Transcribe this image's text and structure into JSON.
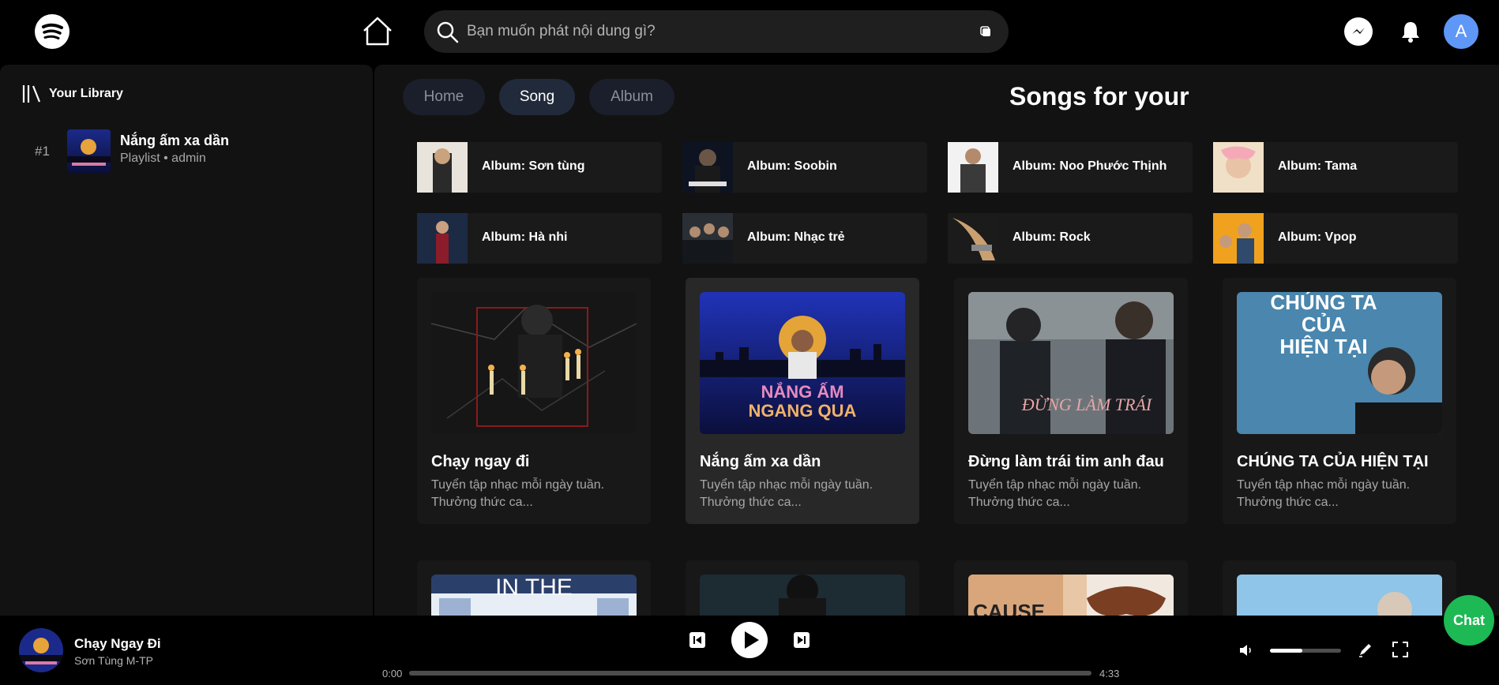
{
  "header": {
    "search_placeholder": "Bạn muốn phát nội dung gì?",
    "avatar_letter": "A"
  },
  "sidebar": {
    "library_label": "Your Library",
    "items": [
      {
        "rank": "#1",
        "title": "Nắng ấm xa dần",
        "subtitle": "Playlist • admin"
      }
    ]
  },
  "main": {
    "tabs": [
      {
        "label": "Home",
        "active": false
      },
      {
        "label": "Song",
        "active": true
      },
      {
        "label": "Album",
        "active": false
      }
    ],
    "section_title": "Songs for your",
    "albums": [
      {
        "label": "Album: Sơn tùng"
      },
      {
        "label": "Album: Soobin"
      },
      {
        "label": "Album: Noo Phước Thịnh"
      },
      {
        "label": "Album: Tama"
      },
      {
        "label": "Album: Hà nhi"
      },
      {
        "label": "Album: Nhạc trẻ"
      },
      {
        "label": "Album: Rock"
      },
      {
        "label": "Album: Vpop"
      }
    ],
    "songs": [
      {
        "title": "Chạy ngay đi",
        "desc": "Tuyển tập nhạc mỗi ngày tuần. Thưởng thức ca..."
      },
      {
        "title": "Nắng ấm xa dần",
        "desc": "Tuyển tập nhạc mỗi ngày tuần. Thưởng thức ca..."
      },
      {
        "title": "Đừng làm trái tim anh đau",
        "desc": "Tuyển tập nhạc mỗi ngày tuần. Thưởng thức ca..."
      },
      {
        "title": "CHÚNG TA CỦA HIỆN TẠI",
        "desc": "Tuyển tập nhạc mỗi ngày tuần. Thưởng thức ca..."
      }
    ],
    "cover_texts": {
      "nang_am_line1": "NẮNG ẤM",
      "nang_am_line2": "NGANG QUA",
      "dung_lam": "ĐỪNG LÀM TRÁI",
      "chung_ta_1": "CHÚNG TA",
      "chung_ta_2": "CỦA",
      "chung_ta_3": "HIỆN TẠI",
      "in_the_dark": "IN THE",
      "cause": "CAUSE"
    }
  },
  "player": {
    "title": "Chạy Ngay Đi",
    "artist": "Sơn Tùng M-TP",
    "current_time": "0:00",
    "total_time": "4:33",
    "progress": 0,
    "volume": 0.45
  },
  "chat_label": "Chat"
}
